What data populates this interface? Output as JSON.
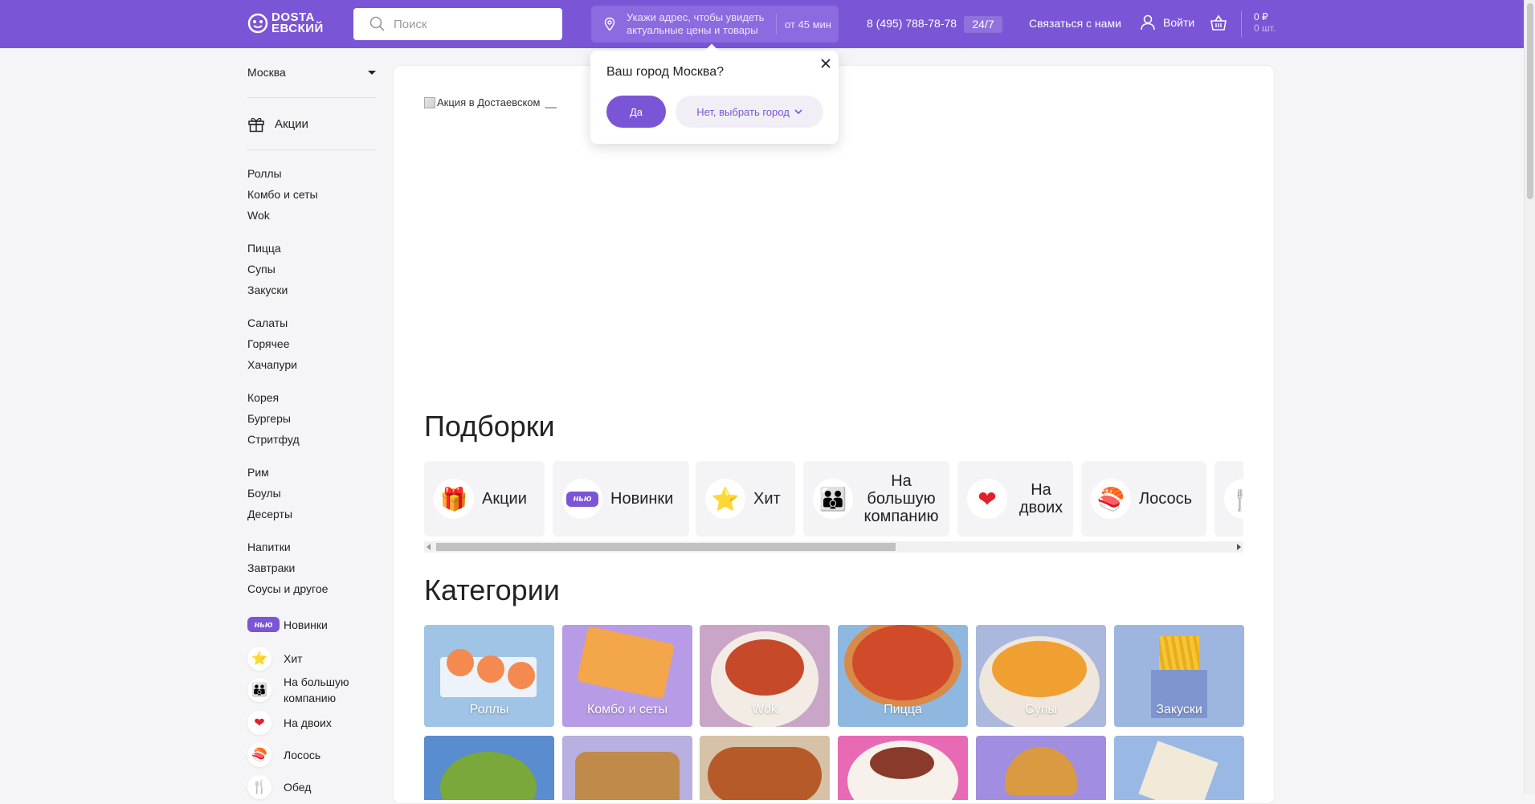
{
  "header": {
    "logo_line1": "DOSTA",
    "logo_line2": "EВСКИЙ",
    "search_placeholder": "Поиск",
    "address_prompt": "Укажи адрес, чтобы увидеть актуальные цены и товары",
    "delivery_time": "от 45 мин",
    "phone": "8 (495) 788-78-78",
    "hours_badge": "24/7",
    "contact_label": "Связаться с нами",
    "login_label": "Войти",
    "cart_sum": "0 ₽",
    "cart_count": "0 шт."
  },
  "city_popup": {
    "title": "Ваш город Москва?",
    "yes_label": "Да",
    "no_label": "Нет, выбрать город"
  },
  "sidebar": {
    "city": "Москва",
    "promo_label": "Акции",
    "groups": [
      [
        "Роллы",
        "Комбо и сеты",
        "Wok"
      ],
      [
        "Пицца",
        "Супы",
        "Закуски"
      ],
      [
        "Салаты",
        "Горячее",
        "Хачапури"
      ],
      [
        "Корея",
        "Бургеры",
        "Стритфуд"
      ],
      [
        "Рим",
        "Боулы",
        "Десерты"
      ],
      [
        "Напитки",
        "Завтраки",
        "Соусы и другое"
      ]
    ],
    "collections": [
      {
        "label": "Новинки",
        "icon": "nyu-badge",
        "badge_text": "нью"
      },
      {
        "label": "Хит",
        "icon": "star-icon",
        "glyph": "⭐"
      },
      {
        "label": "На большую компанию",
        "icon": "family-icon",
        "glyph": "👪"
      },
      {
        "label": "На двоих",
        "icon": "heart-icon",
        "glyph": "❤"
      },
      {
        "label": "Лосось",
        "icon": "salmon-icon",
        "glyph": "🍣"
      },
      {
        "label": "Обед",
        "icon": "cutlery-icon",
        "glyph": "🍴"
      }
    ]
  },
  "main": {
    "banner_alt": "Акция в Достаевском",
    "collections_title": "Подборки",
    "collections": [
      {
        "label": "Акции",
        "icon": "gift-icon",
        "glyph": "🎁"
      },
      {
        "label": "Новинки",
        "icon": "nyu-badge",
        "badge_text": "нью"
      },
      {
        "label": "Хит",
        "icon": "star-icon",
        "glyph": "⭐"
      },
      {
        "label": "На большую компанию",
        "icon": "family-icon",
        "glyph": "👪"
      },
      {
        "label": "На двоих",
        "icon": "heart-icon",
        "glyph": "❤"
      },
      {
        "label": "Лосось",
        "icon": "salmon-icon",
        "glyph": "🍣"
      }
    ],
    "categories_title": "Категории",
    "categories": [
      {
        "label": "Роллы",
        "color": "#9fc4e6"
      },
      {
        "label": "Комбо и сеты",
        "color": "#b79be6"
      },
      {
        "label": "Wok",
        "color": "#c9a6c8"
      },
      {
        "label": "Пицца",
        "color": "#8fb8e0"
      },
      {
        "label": "Супы",
        "color": "#a9b8dc"
      },
      {
        "label": "Закуски",
        "color": "#9cb6e0"
      }
    ],
    "categories_row2_colors": [
      "#5a8cd0",
      "#b8b0e0",
      "#d6c2a6",
      "#e86ab4",
      "#a28ee0",
      "#9ab8e4"
    ]
  },
  "colors": {
    "brand": "#7a55d6",
    "background": "#f5f5f7"
  }
}
